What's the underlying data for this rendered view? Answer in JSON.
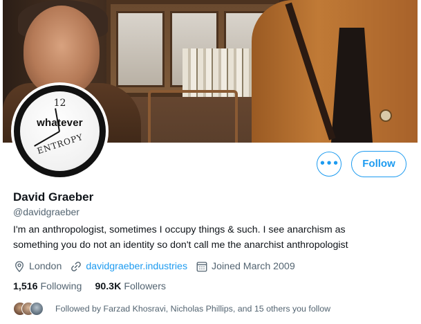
{
  "profile": {
    "name": "David Graeber",
    "handle": "@davidgraeber",
    "bio_lines": [
      "I'm an anthropologist, sometimes I occupy things & such. I see anarchism as",
      "something you do not an identity so don't call me the anarchist anthropologist"
    ],
    "location": "London",
    "website": "davidgraeber.industries",
    "joined": "Joined March 2009",
    "following_count": "1,516",
    "following_label": "Following",
    "followers_count": "90.3K",
    "followers_label": "Followers",
    "followed_by": "Followed by Farzad Khosravi, Nicholas Phillips, and 15 others you follow"
  },
  "avatar": {
    "clock_number": "12",
    "clock_word": "whatever",
    "clock_scribble": "ENTROPY"
  },
  "actions": {
    "more_label": "•••",
    "follow_label": "Follow"
  },
  "colors": {
    "accent": "#1d9bf0",
    "text_primary": "#0f1419",
    "text_secondary": "#536471"
  },
  "icons": {
    "location": "location-pin-icon",
    "website": "link-icon",
    "joined": "calendar-icon",
    "more": "more-icon"
  }
}
